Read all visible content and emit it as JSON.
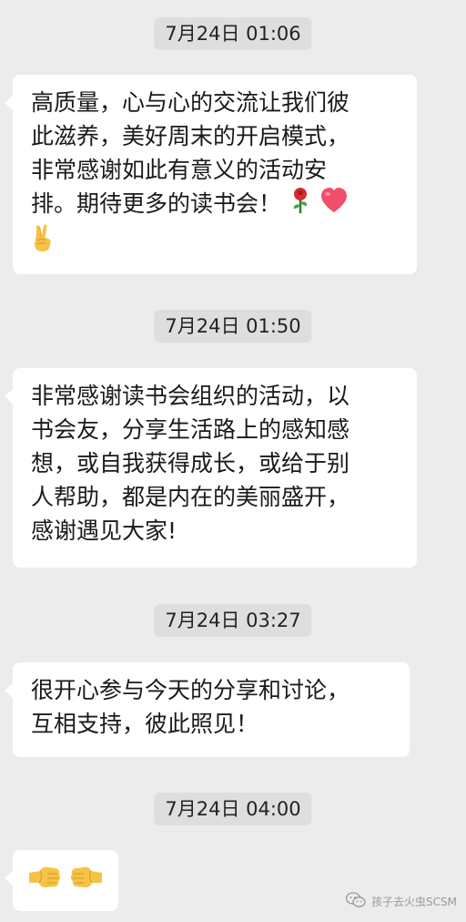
{
  "messages": [
    {
      "timestamp": "7月24日 01:06",
      "lines": [
        "高质量，心与心的交流让我们彼",
        "此滋养，美好周末的开启模式，",
        "非常感谢如此有意义的活动安",
        "排。期待更多的读书会！"
      ],
      "emoji": [
        "rose-icon",
        "heart-icon",
        "victory-hand-icon"
      ]
    },
    {
      "timestamp": "7月24日 01:50",
      "lines": [
        "非常感谢读书会组织的活动，以",
        "书会友，分享生活路上的感知感",
        "想，或自我获得成长，或给于别",
        "人帮助，都是内在的美丽盛开，",
        "感谢遇见大家!"
      ]
    },
    {
      "timestamp": "7月24日 03:27",
      "lines": [
        "很开心参与今天的分享和讨论，",
        "互相支持，彼此照见！"
      ]
    },
    {
      "timestamp": "7月24日 04:00",
      "emoji": [
        "fist-bump-left-icon",
        "fist-bump-right-icon"
      ]
    }
  ],
  "watermark": {
    "text": "孩子去火虫SCSM"
  }
}
